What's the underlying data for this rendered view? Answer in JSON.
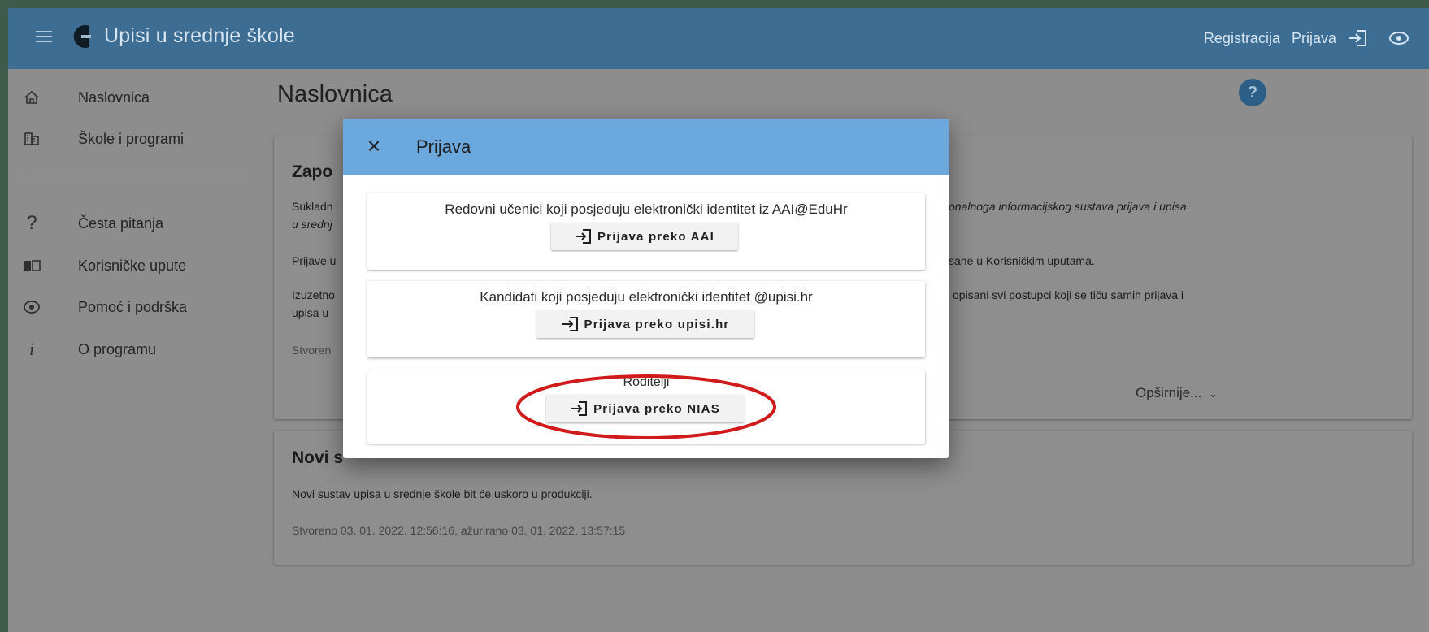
{
  "app": {
    "title": "Upisi u srednje škole"
  },
  "header": {
    "register_label": "Registracija",
    "login_label": "Prijava"
  },
  "sidebar": {
    "items": [
      {
        "label": "Naslovnica",
        "icon": "home-icon"
      },
      {
        "label": "Škole i programi",
        "icon": "building-icon"
      },
      {
        "label": "Česta pitanja",
        "icon": "question-icon"
      },
      {
        "label": "Korisničke upute",
        "icon": "book-icon"
      },
      {
        "label": "Pomoć i podrška",
        "icon": "support-icon"
      },
      {
        "label": "O programu",
        "icon": "info-icon"
      }
    ]
  },
  "main": {
    "page_title": "Naslovnica",
    "help_label": "?",
    "card1": {
      "title": "Zapo",
      "p1_line1": "Sukladn",
      "p1_line1_right": "onalnoga informacijskog sustava prijava i upisa",
      "p1_line2": "u srednj",
      "p2": "Prijave u",
      "p2_right": "sane u Korisničkim uputama.",
      "p3_line1": "Izuzetno",
      "p3_line1_right": "i opisani svi postupci koji se tiču samih prijava i",
      "p3_line2": "upisa u",
      "meta": "Stvoren",
      "more": "Opširnije..."
    },
    "card2": {
      "title": "Novi s",
      "text": "Novi sustav upisa u srednje škole bit će uskoro u produkciji.",
      "meta": "Stvoreno 03. 01. 2022. 12:56:16, ažurirano 03. 01. 2022. 13:57:15"
    }
  },
  "dialog": {
    "title": "Prijava",
    "options": [
      {
        "text": "Redovni učenici koji posjeduju elektronički identitet iz AAI@EduHr",
        "button": "Prijava preko AAI"
      },
      {
        "text": "Kandidati koji posjeduju elektronički identitet @upisi.hr",
        "button": "Prijava preko upisi.hr"
      },
      {
        "text": "Roditelji",
        "button": "Prijava preko NIAS"
      }
    ]
  },
  "colors": {
    "appbar": "#3d6d93",
    "dialog_header": "#6aa8dd",
    "annotation": "#d11a1a"
  }
}
